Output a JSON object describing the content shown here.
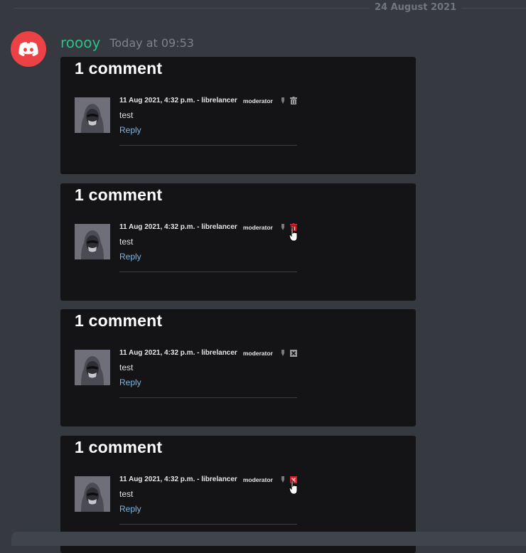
{
  "date_divider": "24 August 2021",
  "message": {
    "username": "roooy",
    "timestamp": "Today at 09:53",
    "avatar_icon": "discord-logo-icon"
  },
  "colors": {
    "background": "#36393f",
    "username": "#2bbf8a",
    "avatar_bg": "#ed4245",
    "card_bg": "#141416",
    "reply_link": "#7ab7e6",
    "delete_active": "#d0202b"
  },
  "cards": [
    {
      "title": "1 comment",
      "meta": "11 Aug 2021, 4:32 p.m. - librelancer",
      "badge": "moderator",
      "text": "test",
      "reply": "Reply",
      "action_icon": "trash-icon",
      "action_state": "normal",
      "hover_cursor": false
    },
    {
      "title": "1 comment",
      "meta": "11 Aug 2021, 4:32 p.m. - librelancer",
      "badge": "moderator",
      "text": "test",
      "reply": "Reply",
      "action_icon": "trash-icon",
      "action_state": "hover",
      "hover_cursor": true
    },
    {
      "title": "1 comment",
      "meta": "11 Aug 2021, 4:32 p.m. - librelancer",
      "badge": "moderator",
      "text": "test",
      "reply": "Reply",
      "action_icon": "delete-x-icon",
      "action_state": "normal",
      "hover_cursor": false
    },
    {
      "title": "1 comment",
      "meta": "11 Aug 2021, 4:32 p.m. - librelancer",
      "badge": "moderator",
      "text": "test",
      "reply": "Reply",
      "action_icon": "delete-x-icon",
      "action_state": "hover",
      "hover_cursor": true
    }
  ]
}
